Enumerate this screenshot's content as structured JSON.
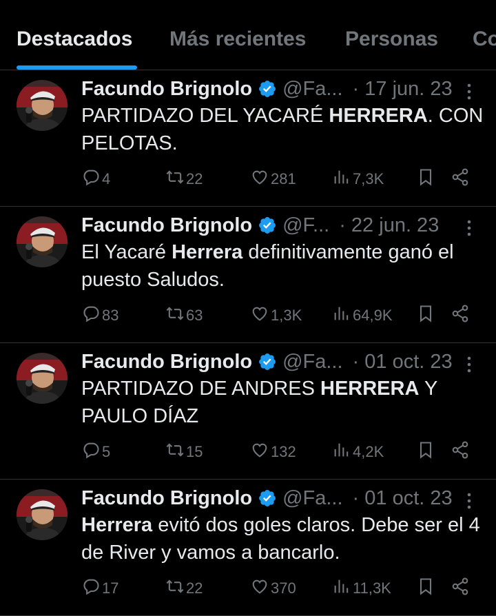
{
  "tabs": [
    {
      "label": "Destacados",
      "active": true
    },
    {
      "label": "Más recientes",
      "active": false
    },
    {
      "label": "Personas",
      "active": false
    },
    {
      "label": "Co",
      "active": false
    }
  ],
  "colors": {
    "accent": "#1d9bf0",
    "background": "#000000",
    "secondary_text": "#71767b",
    "divider": "#2f3336"
  },
  "tweets": [
    {
      "name": "Facundo Brignolo",
      "handle": "@Fa...",
      "date": "· 17 jun. 23",
      "text": [
        {
          "t": "PARTIDAZO DEL YACARÉ "
        },
        {
          "t": "HERRERA",
          "b": true
        },
        {
          "t": ". CON PELOTAS."
        }
      ],
      "replies": "4",
      "retweets": "22",
      "likes": "281",
      "views": "7,3K"
    },
    {
      "name": "Facundo Brignolo",
      "handle": "@F...",
      "date": "· 22 jun. 23",
      "text": [
        {
          "t": "El Yacaré "
        },
        {
          "t": "Herrera",
          "b": true
        },
        {
          "t": " definitivamente ganó el puesto Saludos."
        }
      ],
      "replies": "83",
      "retweets": "63",
      "likes": "1,3K",
      "views": "64,9K"
    },
    {
      "name": "Facundo Brignolo",
      "handle": "@Fa...",
      "date": "· 01 oct. 23",
      "text": [
        {
          "t": "PARTIDAZO DE ANDRES "
        },
        {
          "t": "HERRERA",
          "b": true
        },
        {
          "t": " Y PAULO DÍAZ"
        }
      ],
      "replies": "5",
      "retweets": "15",
      "likes": "132",
      "views": "4,2K"
    },
    {
      "name": "Facundo Brignolo",
      "handle": "@Fa...",
      "date": "· 01 oct. 23",
      "text": [
        {
          "t": "Herrera",
          "b": true
        },
        {
          "t": " evitó dos goles claros. Debe ser el 4 de River y vamos a bancarlo."
        }
      ],
      "replies": "17",
      "retweets": "22",
      "likes": "370",
      "views": "11,3K"
    }
  ]
}
